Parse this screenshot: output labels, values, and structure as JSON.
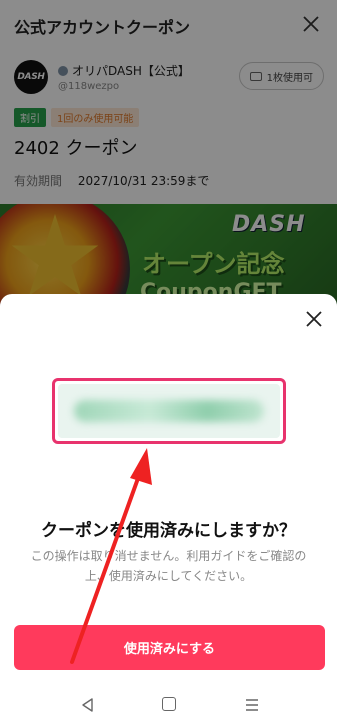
{
  "header": {
    "title": "公式アカウントクーポン"
  },
  "account": {
    "logo_text": "DASH",
    "name": "オリパDASH【公式】",
    "handle": "@118wezpo",
    "usage_chip": "1枚使用可"
  },
  "coupon": {
    "tags": [
      "割引",
      "1回のみ使用可能"
    ],
    "title": "2402 クーポン",
    "validity_label": "有効期間",
    "validity_value": "2027/10/31 23:59まで"
  },
  "banner": {
    "logo_text": "DASH",
    "line1": "オープン記念",
    "line2": "CouponGET"
  },
  "sheet": {
    "heading": "クーポンを使用済みにしますか？",
    "description": "この操作は取り消せません。利用ガイドをご確認の上、使用済みにしてください。",
    "confirm_label": "使用済みにする"
  },
  "colors": {
    "primary_button": "#ff3a5c",
    "highlight_border": "#e8336d",
    "annotation_arrow": "#ee2222",
    "tag_green": "#27a04b",
    "tag_orange": "#e07a2b"
  },
  "icons": [
    "close-icon",
    "verified-badge-icon",
    "ticket-icon",
    "nav-back-icon",
    "nav-home-icon",
    "nav-menu-icon"
  ]
}
